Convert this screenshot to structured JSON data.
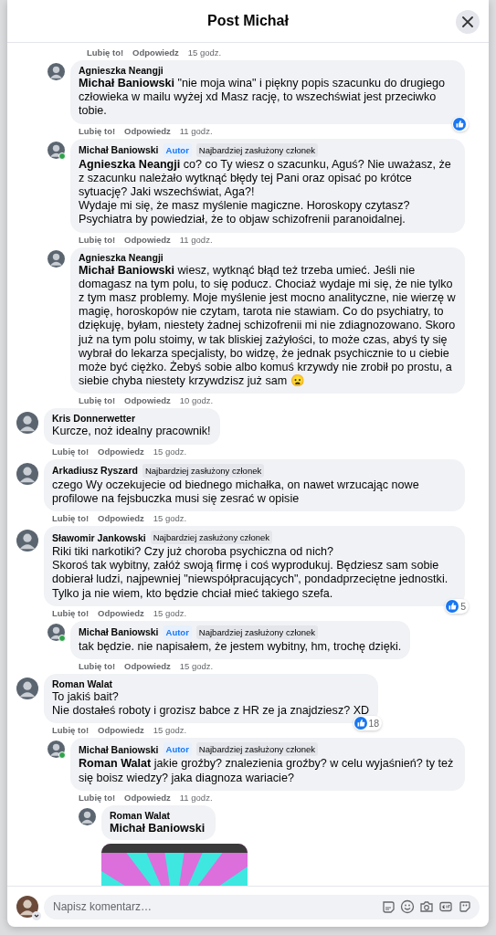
{
  "dialog": {
    "title": "Post Michał"
  },
  "comments": [
    {
      "actions": {
        "like": "Lubię to!",
        "reply": "Odpowiedz",
        "time": "15 godz."
      },
      "children": [
        {
          "author": "Agnieszka Neangji",
          "online": false,
          "text": "**Michał Baniowski** \"nie moja wina\" i piękny popis szacunku do drugiego człowieka w mailu wyżej xd Masz rację, to wszechświat jest przeciwko tobie.",
          "reaction": {
            "kind": "like"
          },
          "actions": {
            "like": "Lubię to!",
            "reply": "Odpowiedz",
            "time": "11 godz."
          }
        },
        {
          "author": "Michał Baniowski",
          "online": true,
          "badges": [
            {
              "kind": "author",
              "label": "Autor"
            },
            {
              "kind": "member",
              "label": "Najbardziej zasłużony członek"
            }
          ],
          "text": "**Agnieszka Neangji** co? co Ty wiesz o szacunku, Aguś? Nie uważasz, że z szacunku należało wytknąć błędy tej Pani oraz opisać po krótce sytuację? Jaki wszechświat, Aga?!\nWydaje mi się, że masz myślenie magiczne. Horoskopy czytasz? Psychiatra by powiedział, że to objaw schizofrenii paranoidalnej.",
          "actions": {
            "like": "Lubię to!",
            "reply": "Odpowiedz",
            "time": "11 godz."
          }
        },
        {
          "author": "Agnieszka Neangji",
          "online": false,
          "text": "**Michał Baniowski** wiesz, wytknąć błąd też trzeba umieć. Jeśli nie domagasz na tym polu, to się poducz. Chociaż wydaje mi się, że nie tylko z tym masz problemy. Moje myślenie jest mocno analityczne, nie wierzę w magię, horoskopów nie czytam, tarota nie stawiam. Co do psychiatry, to dziękuję, byłam, niestety żadnej schizofrenii mi nie zdiagnozowano. Skoro już na tym polu stoimy, w tak bliskiej zażyłości, to może czas, abyś ty się wybrał do lekarza specjalisty, bo widzę, że jednak psychicznie to u ciebie może być ciężko. Żebyś sobie albo komuś krzywdy nie zrobił po prostu, a siebie chyba niestety krzywdzisz już sam 😦",
          "actions": {
            "like": "Lubię to!",
            "reply": "Odpowiedz",
            "time": "10 godz."
          }
        }
      ]
    },
    {
      "author": "Kris Donnerwetter",
      "online": false,
      "text": "Kurcze, noż idealny pracownik!",
      "actions": {
        "like": "Lubię to!",
        "reply": "Odpowiedz",
        "time": "15 godz."
      }
    },
    {
      "author": "Arkadiusz Ryszard",
      "online": false,
      "badges": [
        {
          "kind": "member",
          "label": "Najbardziej zasłużony członek"
        }
      ],
      "text": "czego Wy oczekujecie od biednego michałka, on nawet wrzucając nowe profilowe na fejsbuczka musi się zesrać w opisie",
      "actions": {
        "like": "Lubię to!",
        "reply": "Odpowiedz",
        "time": "15 godz."
      }
    },
    {
      "author": "Sławomir Jankowski",
      "online": false,
      "badges": [
        {
          "kind": "member",
          "label": "Najbardziej zasłużony członek"
        }
      ],
      "text": "Riki tiki narkotiki? Czy już choroba psychiczna od nich?\nSkoroś tak wybitny, załóż swoją firmę i coś wyprodukuj. Będziesz sam sobie dobierał ludzi, najpewniej \"niewspółpracujących\", pondadprzeciętne jednostki. Tylko ja nie wiem, kto będzie chciał mieć takiego szefa.",
      "reaction": {
        "kind": "like",
        "count": "5"
      },
      "actions": {
        "like": "Lubię to!",
        "reply": "Odpowiedz",
        "time": "15 godz."
      },
      "children": [
        {
          "author": "Michał Baniowski",
          "online": true,
          "badges": [
            {
              "kind": "author",
              "label": "Autor"
            },
            {
              "kind": "member",
              "label": "Najbardziej zasłużony członek"
            }
          ],
          "text": "tak będzie. nie napisałem, że jestem wybitny, hm, trochę dzięki.",
          "actions": {
            "like": "Lubię to!",
            "reply": "Odpowiedz",
            "time": "15 godz."
          }
        }
      ]
    },
    {
      "author": "Roman Walat",
      "online": false,
      "text": "To jakiś bait?\nNie dostałeś roboty i grozisz babce z HR ze ja znajdziesz? XD",
      "reaction": {
        "kind": "like",
        "count": "18"
      },
      "actions": {
        "like": "Lubię to!",
        "reply": "Odpowiedz",
        "time": "15 godz."
      },
      "children": [
        {
          "author": "Michał Baniowski",
          "online": true,
          "badges": [
            {
              "kind": "author",
              "label": "Autor"
            },
            {
              "kind": "member",
              "label": "Najbardziej zasłużony członek"
            }
          ],
          "text": "**Roman Walat** jakie groźby? znalezienia groźby? w celu wyjaśnień? ty też się boisz wiedzy? jaka diagnoza wariacie?",
          "actions": {
            "like": "Lubię to!",
            "reply": "Odpowiedz",
            "time": "11 godz."
          },
          "children": [
            {
              "author": "Roman Walat",
              "online": false,
              "mention": "Michał Baniowski"
            }
          ]
        }
      ]
    }
  ],
  "composer": {
    "placeholder": "Napisz komentarz…"
  }
}
